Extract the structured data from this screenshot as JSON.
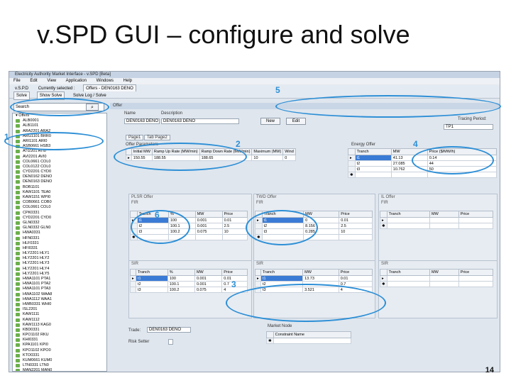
{
  "slide": {
    "title": "v.SPD GUI – configure and solve",
    "page_number": "14"
  },
  "window": {
    "title": "Electricity Authority Market Interface - v.SPD [Beta]",
    "menus": [
      "File",
      "Edit",
      "View",
      "Application",
      "Windows",
      "Help"
    ],
    "toolbar1": {
      "app": "v.S.P.D",
      "selection_text": "Currently selected :",
      "offers_tab": "Offers - DEN0163 DENO"
    },
    "toolbar2": {
      "solve": "Solve",
      "show_solve": "Show Solve",
      "links": "Solve Log / Solve"
    }
  },
  "sidebar": {
    "search_label": "Search",
    "tree_root": "Offers",
    "tree_items": [
      "ALB0001",
      "ALB1101",
      "ARA2201 ARA2",
      "ARG1101 BRR0",
      "ARI1101 ARI0",
      "ASB0661 HSB3",
      "ATI2201 ATI0",
      "AVI2201 AVI0",
      "COL0661 COL0",
      "COL0122 COL0",
      "CYD2201 CYD0",
      "DEN0162 DENO",
      "DEN0163 DENO",
      "BOB1101",
      "KAW1101 TEA0",
      "KAW1151 WPI0",
      "COB0661 COB0",
      "COL0661 COL0",
      "CPK0331",
      "CYD2201 CYD0",
      "GLN0332",
      "GLN0332 GLN0",
      "HWA0331",
      "HFN0331",
      "HLF0331",
      "HFI0331",
      "HLY2201 HLY1",
      "HLY2201 HLY2",
      "HLY2201 HLY3",
      "HLY2201 HLY4",
      "HLY2201 HLY5",
      "HWA1101 PTA1",
      "HWA1101 PTA2",
      "HWA1101 PTA3",
      "HWA1102 WAA8",
      "HWA1112 WAA1",
      "HWB0331 WHI0",
      "ISL2201",
      "KAW1111",
      "KAW1112",
      "KAW1113 KAG0",
      "KBD0331",
      "KPO1102 RKU",
      "KHI0331",
      "KPA1101 KPI0",
      "KPO1102 KPO0",
      "KTO0331",
      "KUM0661 KUM0",
      "LTN0331 LTN0",
      "MAN2201 MAN0"
    ]
  },
  "offer_header": {
    "panel_title": "Offer",
    "name_label": "Name",
    "name_value": "DEN0163 DENO",
    "description_label": "Description",
    "description_value": "DEN0163 DENO",
    "new_button": "New",
    "edit_button": "Edit",
    "tracing_period_label": "Tracing Period:",
    "tracing_period_value": "TP1",
    "tab1": "Page1",
    "tab2": "Tab Page2"
  },
  "offer_parameters": {
    "title": "Offer Parameters",
    "columns": [
      "Initial MW",
      "Ramp Up Rate (MW/min)",
      "Ramp Down Rate (MW/min)",
      "Maximum (MW)",
      "Wind"
    ],
    "row": [
      "150.55",
      "188.55",
      "188.65",
      "10",
      "0"
    ]
  },
  "energy_offer": {
    "title": "Energy Offer",
    "columns": [
      "Tranch",
      "MW",
      "Price ($/MW/h)"
    ],
    "rows": [
      [
        "t1",
        "41.13",
        "0.14"
      ],
      [
        "t2",
        "27.085",
        "44"
      ],
      [
        "t3",
        "10.762",
        "50"
      ]
    ]
  },
  "plsr_offer": {
    "title": "PLSR Offer",
    "fir_label": "FIR",
    "sir_label": "SIR",
    "columns": [
      "Tranch",
      "%",
      "MW",
      "Price"
    ],
    "fir_rows": [
      [
        "t1",
        "100",
        "0.001",
        "0.01"
      ],
      [
        "t2",
        "100.1",
        "0.001",
        "2.5"
      ],
      [
        "t3",
        "100.2",
        "0.075",
        "10"
      ]
    ],
    "sir_rows": [
      [
        "t1",
        "100",
        "0.001",
        "0.01"
      ],
      [
        "t2",
        "100.1",
        "0.001",
        "0.7"
      ],
      [
        "t3",
        "100.2",
        "0.075",
        "4"
      ]
    ]
  },
  "twd_offer": {
    "title": "TWD Offer",
    "columns": [
      "Tranch",
      "MW",
      "Price"
    ],
    "fir_rows": [
      [
        "t1",
        "0",
        "0.01"
      ],
      [
        "t2",
        "8.156",
        "2.5"
      ],
      [
        "t3",
        "0.285",
        "10"
      ]
    ],
    "sir_rows": [
      [
        "t1",
        "13.73",
        "0.01"
      ],
      [
        "t2",
        "",
        "0.7"
      ],
      [
        "t3",
        "3.521",
        "4"
      ]
    ]
  },
  "il_offer": {
    "title": "IL Offer",
    "columns": [
      "Tranch",
      "MW",
      "Price"
    ]
  },
  "trade": {
    "label": "Trade:",
    "value": "DEN0163 DENO",
    "risk_setter_label": "Risk Setter"
  },
  "market_node": {
    "title": "Market Node",
    "column": "Constraint Name"
  },
  "callouts": [
    "1",
    "2",
    "3",
    "4",
    "5",
    "6"
  ]
}
